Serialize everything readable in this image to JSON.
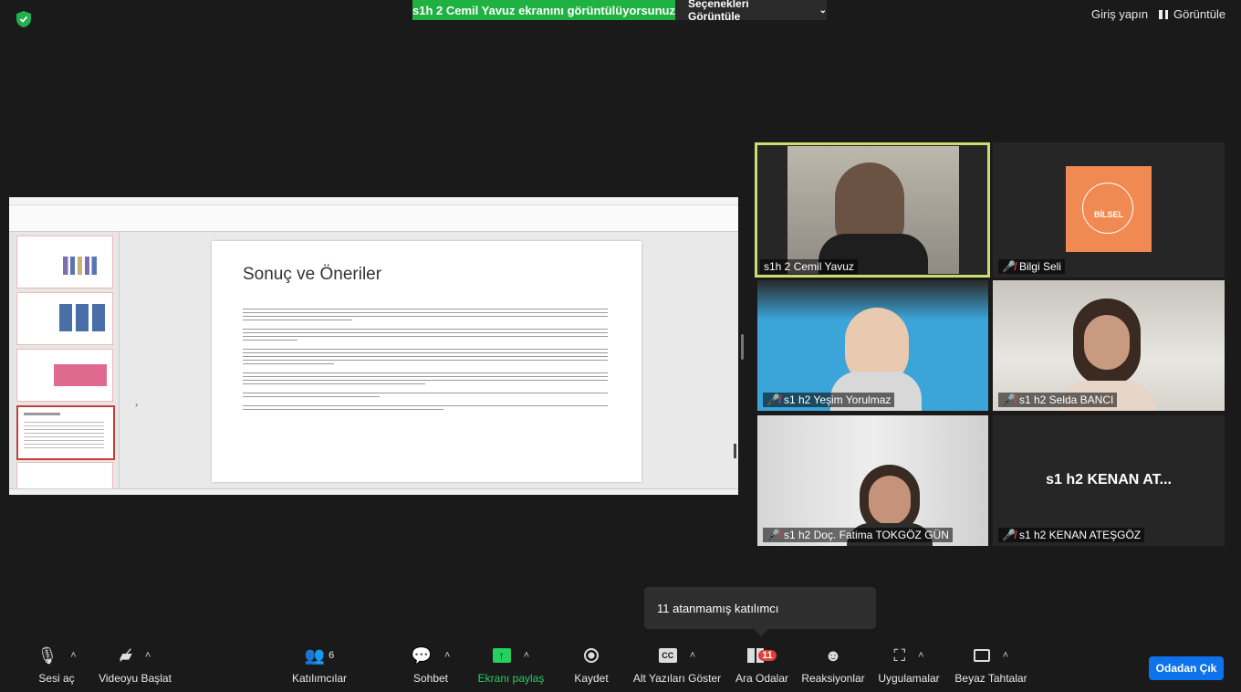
{
  "top": {
    "share_banner": "s1h 2 Cemil Yavuz ekranını görüntülüyorsunuz",
    "view_options": "Seçenekleri Görüntüle",
    "sign_in": "Giriş yapın",
    "view": "Görüntüle"
  },
  "shared_screen": {
    "slide_title": "Sonuç ve Öneriler"
  },
  "participants": [
    {
      "name": "s1h 2 Cemil Yavuz"
    },
    {
      "name": "Bilgi Seli",
      "logo_text": "BİLSEL"
    },
    {
      "name": "s1 h2  Yeşim Yorulmaz"
    },
    {
      "name": "s1 h2  Selda BANCI"
    },
    {
      "name": "s1 h2  Doç. Fatima TOKGÖZ GÜN"
    },
    {
      "name": "s1 h2 KENAN ATEŞGÖZ",
      "display": "s1 h2 KENAN AT..."
    }
  ],
  "tooltip": "11 atanmamış katılımcı",
  "toolbar": {
    "unmute": "Sesi aç",
    "start_video": "Videoyu Başlat",
    "participants": "Katılımcılar",
    "participants_count": "6",
    "chat": "Sohbet",
    "share_screen": "Ekranı paylaş",
    "record": "Kaydet",
    "captions": "Alt Yazıları Göster",
    "breakout": "Ara Odalar",
    "breakout_badge": "11",
    "reactions": "Reaksiyonlar",
    "apps": "Uygulamalar",
    "whiteboard": "Beyaz Tahtalar",
    "leave_room": "Odadan Çık"
  },
  "colors": {
    "share_green": "#1fb141",
    "active_speaker": "#c8de6e",
    "leave_blue": "#0e72ed"
  }
}
